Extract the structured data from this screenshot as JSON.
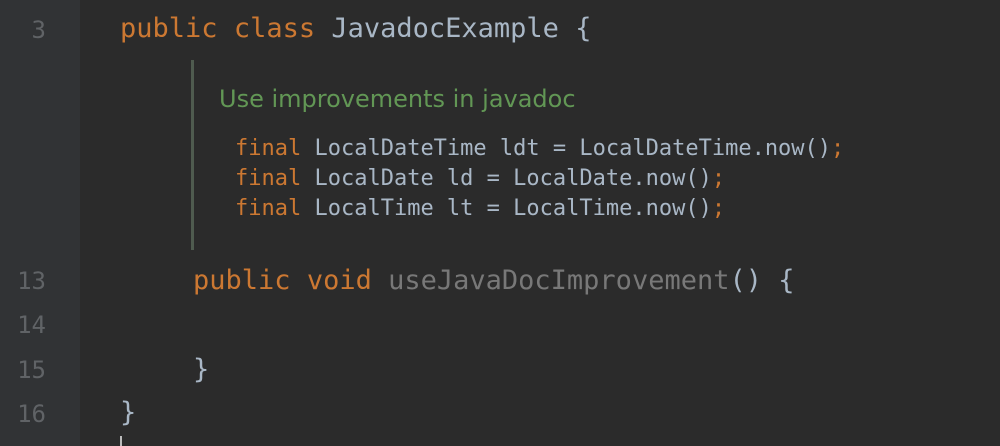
{
  "editor": {
    "line_numbers": {
      "l3": "3",
      "l13": "13",
      "l14": "14",
      "l15": "15",
      "l16": "16"
    },
    "class_decl": {
      "kw_public": "public",
      "kw_class": "class",
      "name": "JavadocExample",
      "open": "{"
    },
    "javadoc": {
      "text": "Use improvements in javadoc",
      "lines": [
        {
          "kw": "final",
          "rest": " LocalDateTime ldt = LocalDateTime.now()",
          "semi": ";"
        },
        {
          "kw": "final",
          "rest": " LocalDate ld = LocalDate.now()",
          "semi": ";"
        },
        {
          "kw": "final",
          "rest": " LocalTime lt = LocalTime.now()",
          "semi": ";"
        }
      ]
    },
    "method_decl": {
      "kw_public": "public",
      "kw_void": "void",
      "name": "useJavaDocImprovement",
      "parens": "()",
      "open": "{"
    },
    "method_close": "}",
    "class_close": "}"
  },
  "colors": {
    "background": "#2b2b2b",
    "keyword": "#cc7832",
    "text": "#a9b7c6",
    "unused_method": "#787878",
    "doc_comment": "#629755",
    "line_number": "#606366"
  }
}
